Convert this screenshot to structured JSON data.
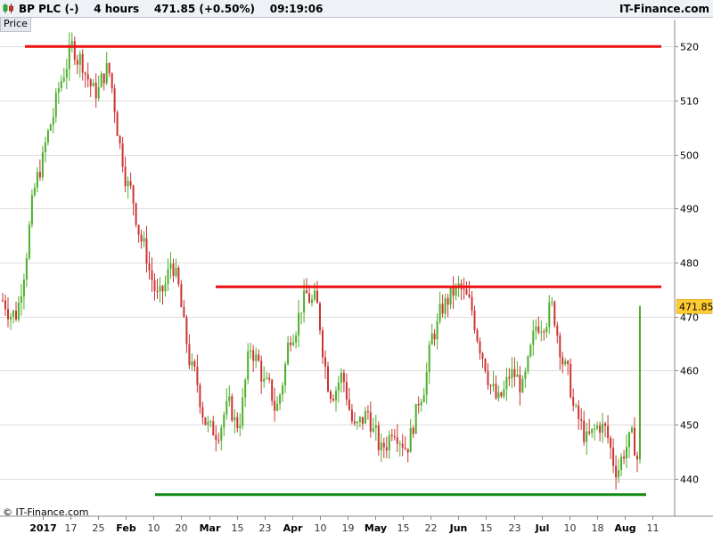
{
  "header": {
    "instrument": "BP PLC (-)",
    "interval": "4 hours",
    "last_price": "471.85 (+0.50%)",
    "time": "09:19:06",
    "brand": "IT-Finance.com"
  },
  "price_tab": "Price",
  "credit": "© IT-Finance.com",
  "colors": {
    "up": "#4caf2a",
    "down": "#cc3333",
    "resistance": "#ee1111",
    "support": "#118811",
    "grid": "#dddddd",
    "label_bg": "#ffcc33"
  },
  "chart_data": {
    "type": "candlestick",
    "ylim": [
      433,
      525
    ],
    "yticks": [
      440,
      450,
      460,
      470,
      480,
      490,
      500,
      510,
      520
    ],
    "grid": "horizontal",
    "last_price_label": "471.85",
    "xticks": [
      {
        "label": "2017",
        "bold": true
      },
      {
        "label": "17"
      },
      {
        "label": "25"
      },
      {
        "label": "Feb",
        "bold": true
      },
      {
        "label": "10"
      },
      {
        "label": "20"
      },
      {
        "label": "Mar",
        "bold": true
      },
      {
        "label": "15"
      },
      {
        "label": "23"
      },
      {
        "label": "Apr",
        "bold": true
      },
      {
        "label": "10"
      },
      {
        "label": "19"
      },
      {
        "label": "May",
        "bold": true
      },
      {
        "label": "15"
      },
      {
        "label": "22"
      },
      {
        "label": "Jun",
        "bold": true
      },
      {
        "label": "15"
      },
      {
        "label": "23"
      },
      {
        "label": "Jul",
        "bold": true
      },
      {
        "label": "10"
      },
      {
        "label": "18"
      },
      {
        "label": "Aug",
        "bold": true
      },
      {
        "label": "11"
      }
    ],
    "anchor_closes": [
      473,
      470,
      490,
      500,
      510,
      520,
      518,
      510,
      517,
      500,
      490,
      480,
      471,
      482,
      463,
      455,
      447,
      454,
      449,
      466,
      457,
      452,
      468,
      474,
      472,
      456,
      460,
      447,
      453,
      443,
      452,
      446,
      456,
      467,
      473,
      475,
      470,
      462,
      452,
      460,
      456,
      469,
      473,
      462,
      450,
      446,
      451,
      441,
      448,
      442
    ],
    "resistance_levels": [
      {
        "value": 520,
        "from": "2016-12-29",
        "to": "2017-08-11"
      },
      {
        "value": 475.5,
        "from": "2017-03-06",
        "to": "2017-08-11"
      }
    ],
    "support_levels": [
      {
        "value": 437,
        "from": "2017-02-08",
        "to": "2017-08-09"
      }
    ]
  }
}
